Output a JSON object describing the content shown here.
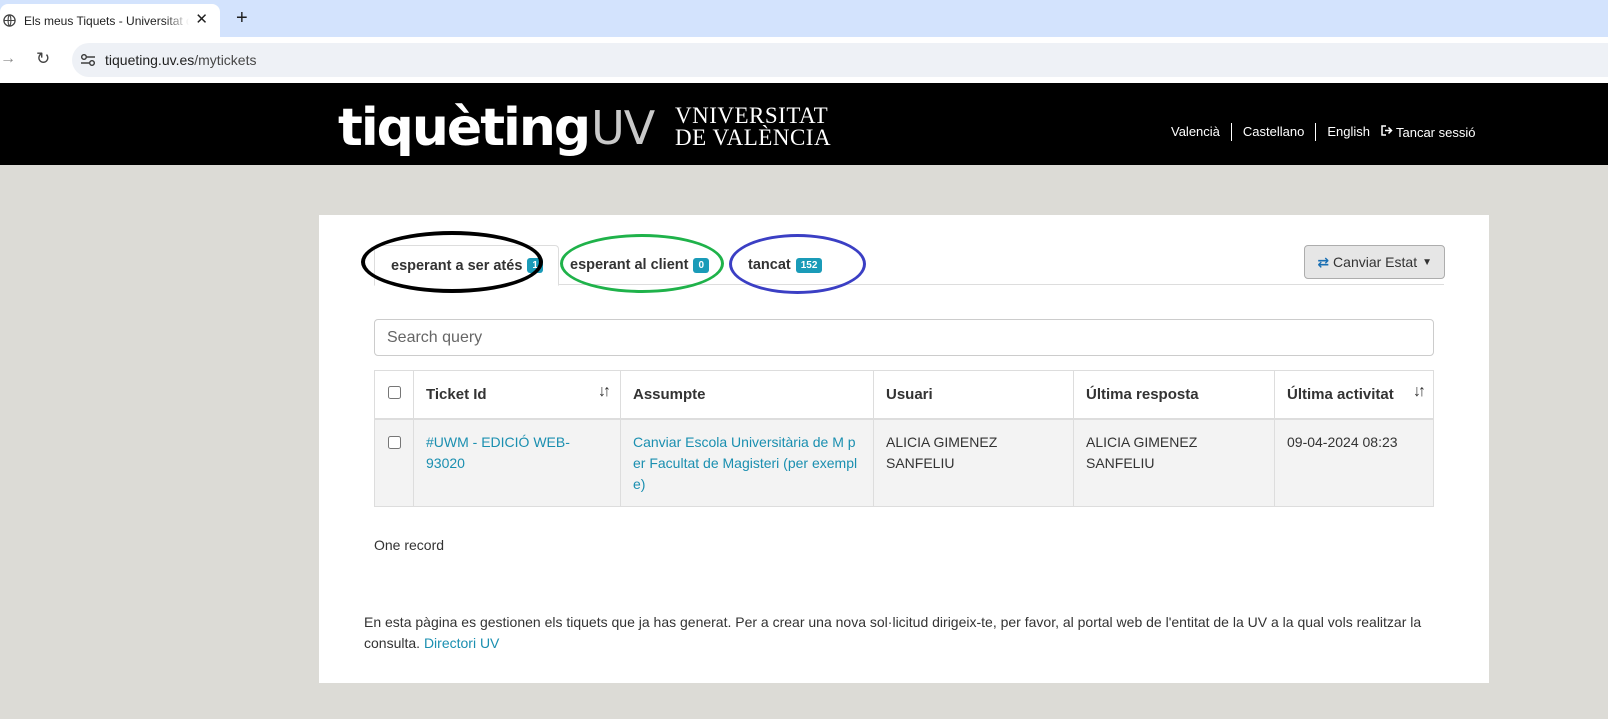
{
  "browser": {
    "tab_title": "Els meus Tiquets - Universitat de València",
    "close_symbol": "✕",
    "new_tab_symbol": "+",
    "url_host": "tiqueting.uv.es",
    "url_path": "/mytickets"
  },
  "header": {
    "logo_main": "tiquèting",
    "logo_suffix": "UV",
    "univ_line1": "VNIVERSITAT",
    "univ_line2": "DE VALÈNCIA",
    "languages": [
      "Valencià",
      "Castellano",
      "English"
    ],
    "logout_label": "Tancar sessió"
  },
  "tabs": [
    {
      "label": "esperant a ser atés",
      "count": "1"
    },
    {
      "label": "esperant al client",
      "count": "0"
    },
    {
      "label": "tancat",
      "count": "152"
    }
  ],
  "change_state_button": {
    "label": "Canviar Estat"
  },
  "search": {
    "placeholder": "Search query"
  },
  "table": {
    "headers": [
      "Ticket Id",
      "Assumpte",
      "Usuari",
      "Última resposta",
      "Última activitat"
    ],
    "rows": [
      {
        "ticket_id": "#UWM - EDICIÓ WEB-93020",
        "subject": "Canviar Escola Universitària de M per Facultat de Magisteri (per exemple)",
        "user": "ALICIA GIMENEZ SANFELIU",
        "last_reply": "ALICIA GIMENEZ SANFELIU",
        "last_activity": "09-04-2024 08:23"
      }
    ]
  },
  "record_count": "One record",
  "footer": {
    "text": "En esta pàgina es gestionen els tiquets que ja has generat. Per a crear una nova sol·licitud dirigeix-te, per favor, al portal web de l'entitat de la UV a la qual vols realitzar la consulta.",
    "link_label": "Directori UV"
  },
  "annotation_colors": [
    "#000000",
    "#1fb24a",
    "#3b3fc4"
  ],
  "colors": {
    "badge": "#1a9bb8",
    "link": "#1a8fb0",
    "header_bg": "#000000",
    "page_bg": "#dcdbd6"
  }
}
